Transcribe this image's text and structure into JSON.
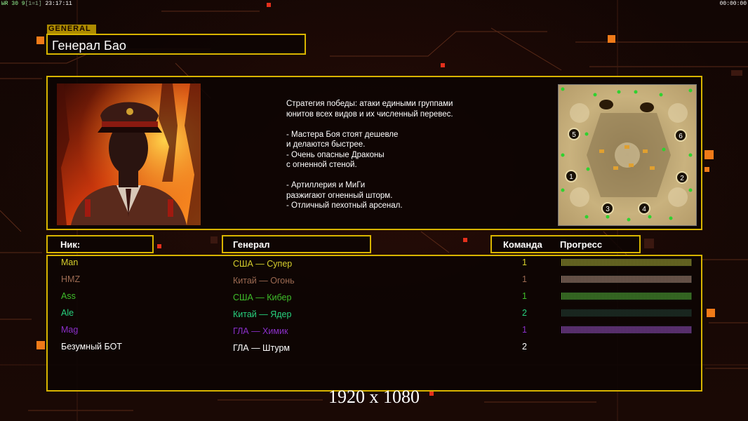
{
  "hud": {
    "left": "ЫR 30 9",
    "left_bracket": "[1=1]",
    "left_time": "23:17:11",
    "right_time": "00:00:00"
  },
  "header": {
    "tag": "GENERAL",
    "general_name": "Генерал Бао"
  },
  "description": [
    "Стратегия победы: атаки едиными группами",
    "юнитов всех видов и их численный перевес.",
    "",
    "- Мастера Боя стоят дешевле",
    "и делаются быстрее.",
    "- Очень опасные Драконы",
    "с огненной стеной.",
    "",
    "- Артиллерия и МиГи",
    "разжигают огненный шторм.",
    "- Отличный пехотный арсенал."
  ],
  "map": {
    "start_positions": [
      "1",
      "2",
      "3",
      "4",
      "5",
      "6"
    ]
  },
  "table": {
    "col_nick": "Ник:",
    "col_general": "Генерал",
    "col_team": "Команда",
    "col_progress": "Прогресс"
  },
  "players": [
    {
      "nick": "Man",
      "general": "США — Супер",
      "team": "1",
      "color": "#d6cf2c",
      "progress": 1.0,
      "bar_color": "#bfc03a"
    },
    {
      "nick": "HMZ",
      "general": "Китай — Огонь",
      "team": "1",
      "color": "#9c6a52",
      "progress": 1.0,
      "bar_color": "#c49d8a"
    },
    {
      "nick": "Ass",
      "general": "США — Кибер",
      "team": "1",
      "color": "#3fbf2a",
      "progress": 1.0,
      "bar_color": "#5ec63c"
    },
    {
      "nick": "Ale",
      "general": "Китай — Ядер",
      "team": "2",
      "color": "#27d27e",
      "progress": 0.0,
      "bar_color": "#2a4d3f"
    },
    {
      "nick": "Mag",
      "general": "ГЛА — Химик",
      "team": "1",
      "color": "#8b2fc9",
      "progress": 1.0,
      "bar_color": "#a955d8"
    },
    {
      "nick": "Безумный БОТ",
      "general": "ГЛА — Штурм",
      "team": "2",
      "color": "#ffffff",
      "progress": null,
      "bar_color": ""
    }
  ],
  "resolution_label": "1920 x 1080",
  "colors": {
    "frame": "#d8b400",
    "accent_orange": "#f08a1a"
  }
}
